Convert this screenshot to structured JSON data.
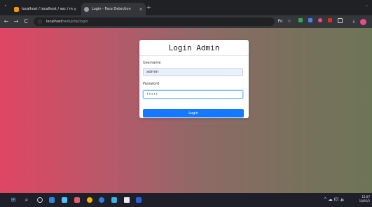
{
  "browser": {
    "tabs": [
      {
        "title": "localhost / localhost / sec / mai",
        "close": "×",
        "fav_color": "#f29900"
      },
      {
        "title": "Login - Face Detection",
        "close": "×",
        "fav_color": "#9aa0a6"
      }
    ],
    "new_tab": "+",
    "tab_menu": "˅",
    "window_minimize": "–",
    "address": {
      "host": "localhost",
      "path": "/web/php/login"
    },
    "nav": {
      "back": "←",
      "forward": "→",
      "reload": "C",
      "info": "ⓘ"
    },
    "toolbar_icons": {
      "translate": "Po",
      "bookmark": "☆",
      "download": "⤓"
    }
  },
  "login": {
    "title": "Login Admin",
    "username_label": "Username",
    "username_value": "admin",
    "password_label": "Password",
    "password_value": "•••••",
    "button_label": "Login"
  },
  "taskbar": {
    "start": "⊞",
    "search": "⌕",
    "tray": "^ ☁ ((( 🔈",
    "time": "15:07",
    "date": "10/05/2"
  },
  "colors": {
    "primary": "#1479ff",
    "gradient_start": "#e04663",
    "gradient_end": "#6d7557"
  }
}
